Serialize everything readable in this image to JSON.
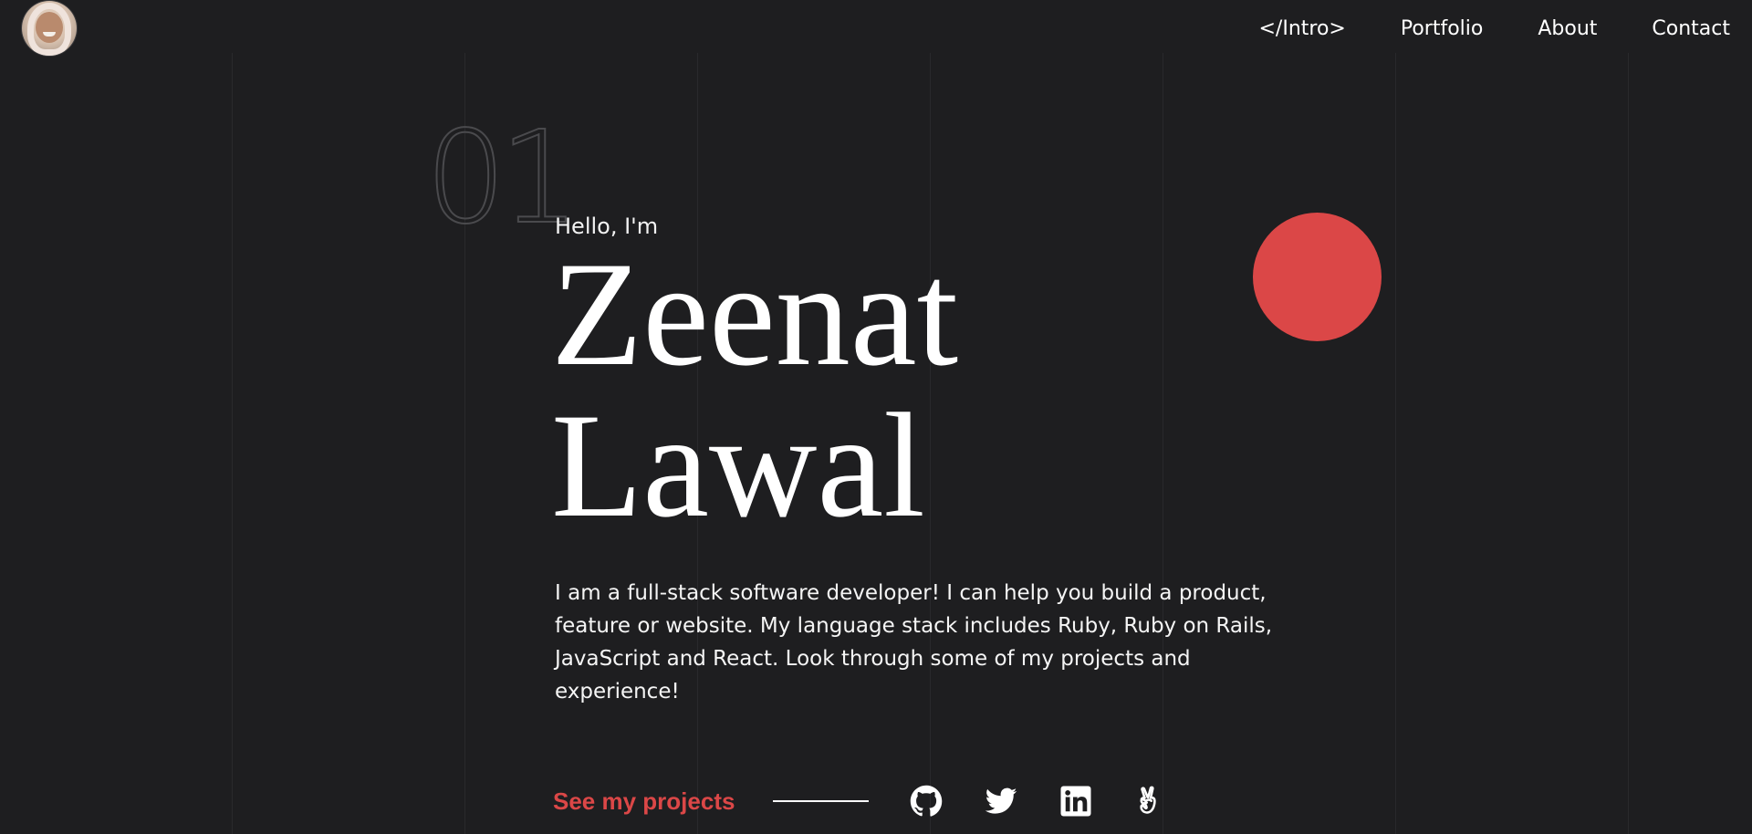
{
  "navbar": {
    "avatar_alt": "Zeenat Lawal avatar",
    "links": [
      {
        "label": "</Intro>"
      },
      {
        "label": "Portfolio"
      },
      {
        "label": "About"
      },
      {
        "label": "Contact"
      }
    ]
  },
  "hero": {
    "section_number": "01",
    "greeting": "Hello, I'm",
    "first_name": "Zeenat",
    "last_name": "Lawal",
    "intro": "I am a full-stack software developer! I can help you build a product, feature or website. My language stack includes Ruby, Ruby on Rails, JavaScript and React. Look through some of my projects and experience!",
    "cta_label": "See my projects"
  },
  "social": [
    {
      "icon": "github-icon"
    },
    {
      "icon": "twitter-icon"
    },
    {
      "icon": "linkedin-icon"
    },
    {
      "icon": "angellist-icon"
    }
  ],
  "colors": {
    "background": "#1e1e20",
    "accent": "#db4747",
    "text": "#ffffff",
    "grid_line": "#29292c"
  }
}
